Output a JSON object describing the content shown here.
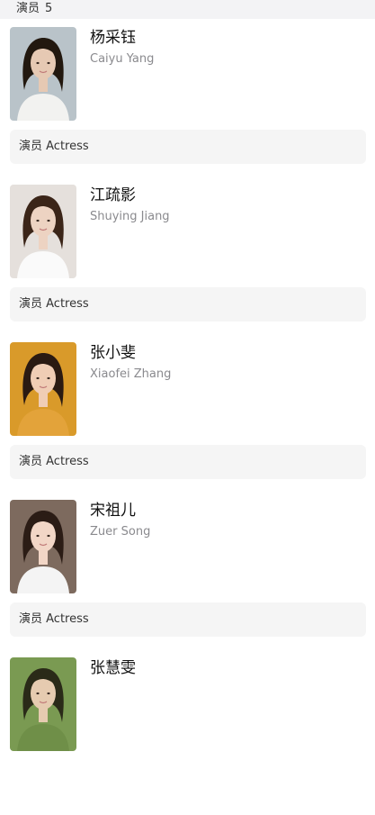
{
  "section": {
    "label": "演员",
    "count": "5"
  },
  "cast": [
    {
      "name_zh": "杨采钰",
      "name_en": "Caiyu Yang",
      "role": "演员 Actress",
      "photo": {
        "bg": "#b9c3c9",
        "hair": "#22180f",
        "skin": "#e6c9b3",
        "cloth": "#f2f2f0"
      }
    },
    {
      "name_zh": "江疏影",
      "name_en": "Shuying Jiang",
      "role": "演员 Actress",
      "photo": {
        "bg": "#e5e0dc",
        "hair": "#3b2518",
        "skin": "#edd3c2",
        "cloth": "#fafafa"
      }
    },
    {
      "name_zh": "张小斐",
      "name_en": "Xiaofei Zhang",
      "role": "演员 Actress",
      "photo": {
        "bg": "#d99a2a",
        "hair": "#2a1a12",
        "skin": "#f0cdb5",
        "cloth": "#e3a33a"
      }
    },
    {
      "name_zh": "宋祖儿",
      "name_en": "Zuer Song",
      "role": "演员 Actress",
      "photo": {
        "bg": "#7d6a5e",
        "hair": "#2b1c15",
        "skin": "#f2d6c6",
        "cloth": "#f4f4f4"
      }
    },
    {
      "name_zh": "张慧雯",
      "name_en": "",
      "role": "",
      "photo": {
        "bg": "#7a9a52",
        "hair": "#2a2a18",
        "skin": "#e6cbb0",
        "cloth": "#6f8f48"
      }
    }
  ]
}
